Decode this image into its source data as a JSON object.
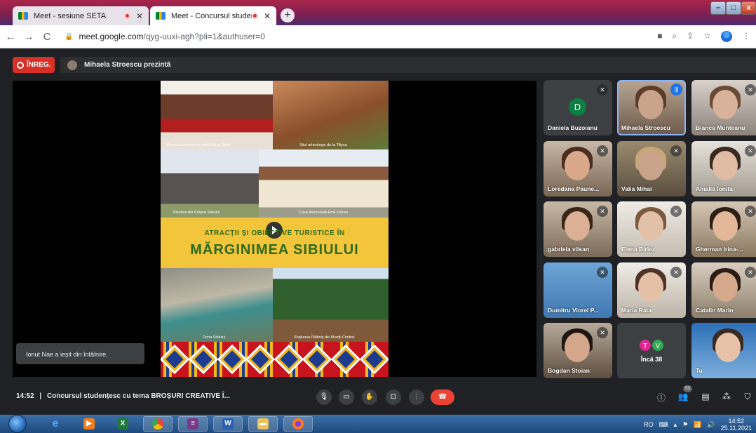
{
  "browser": {
    "tabs": [
      {
        "title": "Meet - sesiune SETA",
        "recording": true
      },
      {
        "title": "Meet - Concursul studențesc",
        "recording": true
      }
    ],
    "new_tab": "+",
    "url_host": "meet.google.com",
    "url_path": "/qyg-uuxi-agh?pli=1&authuser=0",
    "window_controls": {
      "minimize": "–",
      "maximize": "□",
      "close": "x"
    }
  },
  "meet": {
    "recording_label": "ÎNREG.",
    "presenter_text": "Mihaela Stroescu prezintă",
    "slide": {
      "subtitle": "ATRACȚII ȘI OBIECTIVE TURISTICE ÎN",
      "title": "MĂRGINIMEA SIBIULUI",
      "captions": [
        "Muzeul icoanelor pe sticlă de la Sibiel",
        "Situl arheologic de la Tilișca",
        "Biserica din Poiana Sibiului",
        "Casa Memorială Emil Cioran",
        "Ocna Sibiului",
        "Stațiunea Păltiniș din Munții Cindrel"
      ]
    },
    "toast": "Ionut Nae a ieșit din întâlnire.",
    "participants": [
      {
        "name": "Daniela Buzoianu",
        "initial": "D"
      },
      {
        "name": "Mihaela Stroescu"
      },
      {
        "name": "Bianca Munteanu"
      },
      {
        "name": "Loredana Paune..."
      },
      {
        "name": "Valia Mihai"
      },
      {
        "name": "Amalia Ionita"
      },
      {
        "name": "gabriela vilsan"
      },
      {
        "name": "Elena Birlez"
      },
      {
        "name": "Gherman Irina-..."
      },
      {
        "name": "Dumitru Viorel P..."
      },
      {
        "name": "Maria Rata"
      },
      {
        "name": "Catalin Marin"
      },
      {
        "name": "Bogdan Stoian"
      },
      {
        "name": "Tu"
      }
    ],
    "more": {
      "label": "Încă 38",
      "avatars": [
        "T",
        "V"
      ]
    },
    "bottom": {
      "time": "14:52",
      "separator": "|",
      "meeting_title": "Concursul studențesc cu tema BROȘURI CREATIVE Î...",
      "people_count": "53"
    }
  },
  "taskbar": {
    "language": "RO",
    "time": "14:52",
    "date": "25.11.2021"
  },
  "colors": {
    "meet_bg": "#202124",
    "record_red": "#d93025",
    "hangup_red": "#ea4335",
    "slide_banner": "#f3c53a",
    "slide_green": "#2d6a1d"
  }
}
